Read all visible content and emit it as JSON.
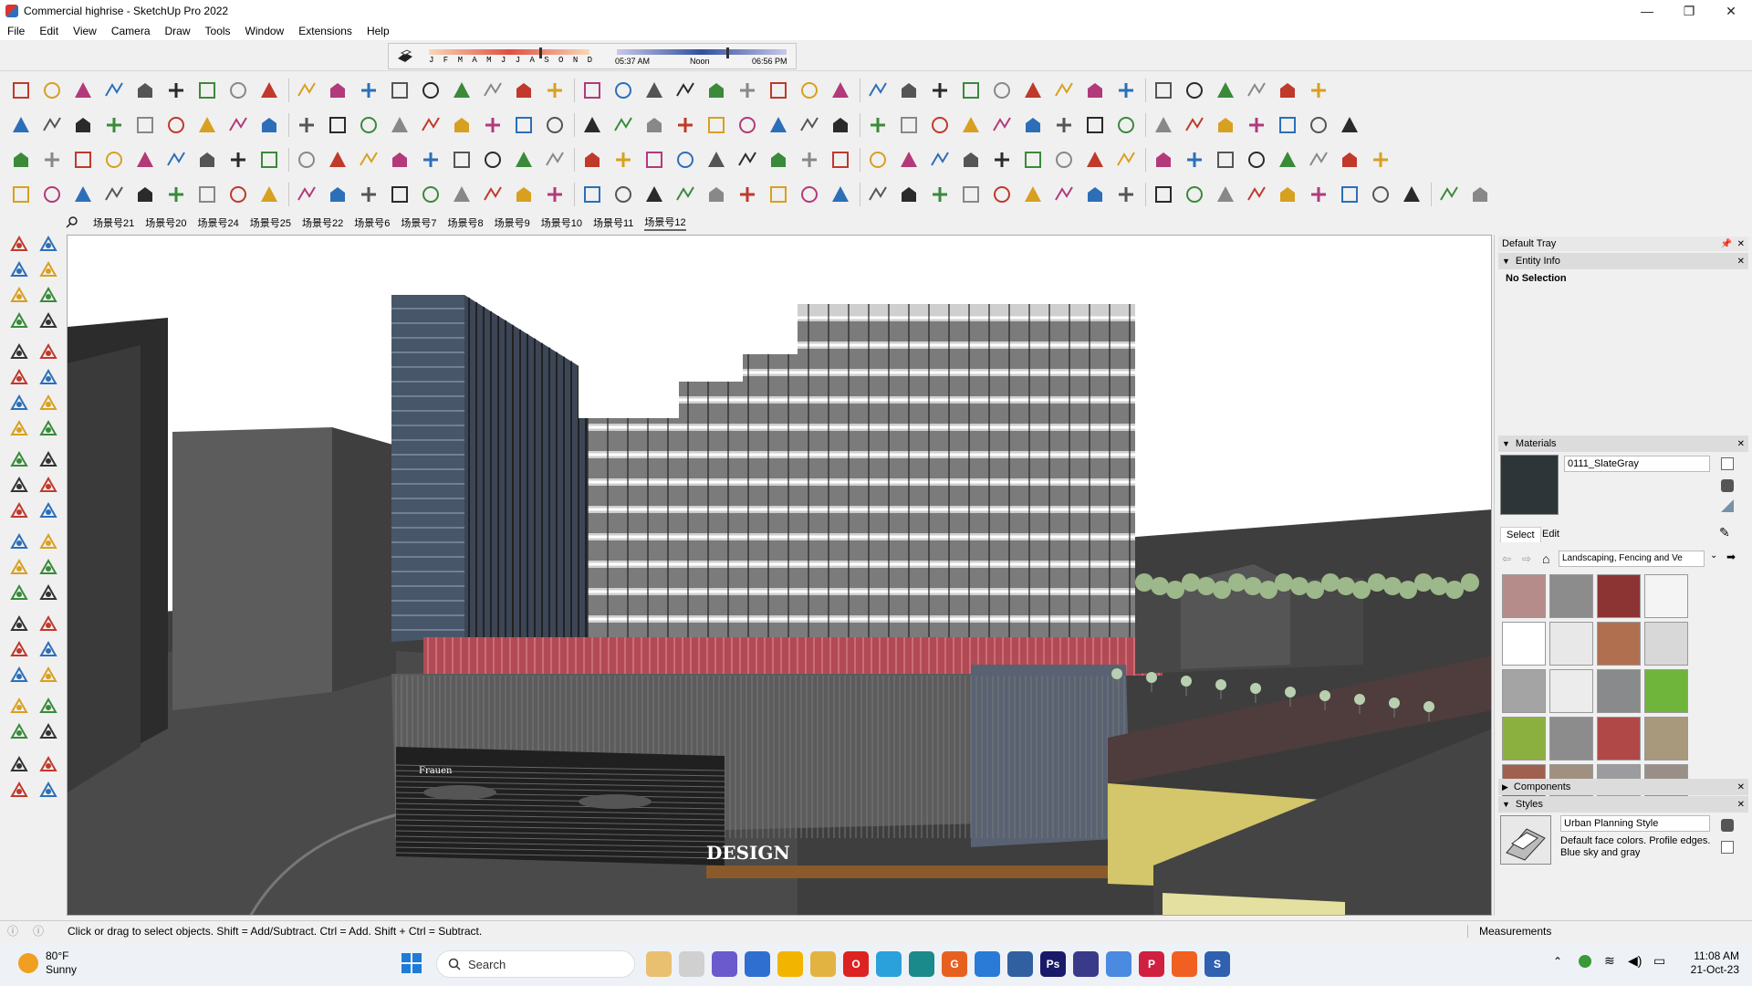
{
  "titlebar": {
    "title": "Commercial highrise - SketchUp Pro 2022",
    "minimize": "—",
    "maximize": "❐",
    "close": "✕"
  },
  "menu": [
    "File",
    "Edit",
    "View",
    "Camera",
    "Draw",
    "Tools",
    "Window",
    "Extensions",
    "Help"
  ],
  "shadow": {
    "months": [
      "J",
      "F",
      "M",
      "A",
      "M",
      "J",
      "J",
      "A",
      "S",
      "O",
      "N",
      "D"
    ],
    "sunrise": "05:37 AM",
    "noon": "Noon",
    "sunset": "06:56 PM"
  },
  "scenes": {
    "tabs": [
      "场景号21",
      "场景号20",
      "场景号24",
      "场景号25",
      "场景号22",
      "场景号6",
      "场景号7",
      "场景号8",
      "场景号9",
      "场景号10",
      "场景号11",
      "场景号12"
    ],
    "active": "场景号12"
  },
  "viewport": {
    "sign_left": "Frauen",
    "sign_design": "DESIGN"
  },
  "tray": {
    "title": "Default Tray",
    "entity_info": {
      "label": "Entity Info",
      "value": "No Selection"
    },
    "materials": {
      "label": "Materials",
      "current_name": "0111_SlateGray",
      "current_color": "#2e3538",
      "tab_select": "Select",
      "tab_edit": "Edit",
      "library": "Landscaping, Fencing and Ve",
      "swatch_colors": [
        "#b58c8a",
        "#8c8c8c",
        "#8c3434",
        "#f4f4f4",
        "#ffffff",
        "#e8e8e8",
        "#b07050",
        "#d8d8d8",
        "#a4a4a4",
        "#ececec",
        "#888a8c",
        "#6fb53c",
        "#8cb040",
        "#8c8c8c",
        "#b04848",
        "#a8987c",
        "#a06050",
        "#a09080",
        "#9c9ca0",
        "#989088"
      ]
    },
    "components": {
      "label": "Components"
    },
    "styles": {
      "label": "Styles",
      "name": "Urban Planning Style",
      "description": "Default face colors.  Profile edges.  Blue sky and gray"
    }
  },
  "statusbar": {
    "hint": "Click or drag to select objects. Shift = Add/Subtract. Ctrl = Add. Shift + Ctrl = Subtract.",
    "measurements": "Measurements"
  },
  "taskbar": {
    "weather_temp": "80°F",
    "weather_desc": "Sunny",
    "search": "Search",
    "time": "11:08 AM",
    "date": "21-Oct-23"
  }
}
